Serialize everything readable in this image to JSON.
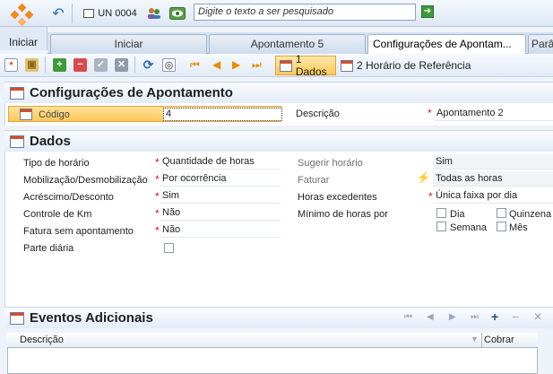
{
  "topbar": {
    "user_code": "UN 0004",
    "search_placeholder": "Digite o texto a ser pesquisado"
  },
  "start": {
    "label": "Iniciar"
  },
  "tabs": [
    {
      "label": "Iniciar"
    },
    {
      "label": "Apontamento 5"
    },
    {
      "label": "Configurações de Apontam..."
    },
    {
      "label": "Parâ"
    }
  ],
  "toolbar": {
    "dados_label": "1 Dados",
    "horario_label": "2 Horário de Referência"
  },
  "config": {
    "title": "Configurações de Apontamento",
    "codigo_label": "Código",
    "codigo_value": "4",
    "descricao_label": "Descrição",
    "descricao_value": "Apontamento 2"
  },
  "dados": {
    "title": "Dados",
    "left": [
      {
        "label": "Tipo de horário",
        "value": "Quantidade de horas",
        "required": true
      },
      {
        "label": "Mobilização/Desmobilização",
        "value": "Por ocorrência",
        "required": true
      },
      {
        "label": "Acréscimo/Desconto",
        "value": "Sim",
        "required": true
      },
      {
        "label": "Controle de Km",
        "value": "Não",
        "required": true
      },
      {
        "label": "Fatura sem apontamento",
        "value": "Não",
        "required": true
      },
      {
        "label": "Parte diária",
        "value": ""
      }
    ],
    "right": [
      {
        "label": "Sugerir horário",
        "value": "Sim"
      },
      {
        "label": "Faturar",
        "value": "Todas as horas"
      },
      {
        "label": "Horas excedentes",
        "value": "Única faixa por dia",
        "required": true
      },
      {
        "label": "Mínimo de horas por"
      }
    ],
    "periods": [
      "Dia",
      "Quinzena",
      "Semana",
      "Mês"
    ]
  },
  "eventos": {
    "title": "Eventos Adicionais",
    "columns": [
      "Descrição",
      "Cobrar"
    ]
  }
}
